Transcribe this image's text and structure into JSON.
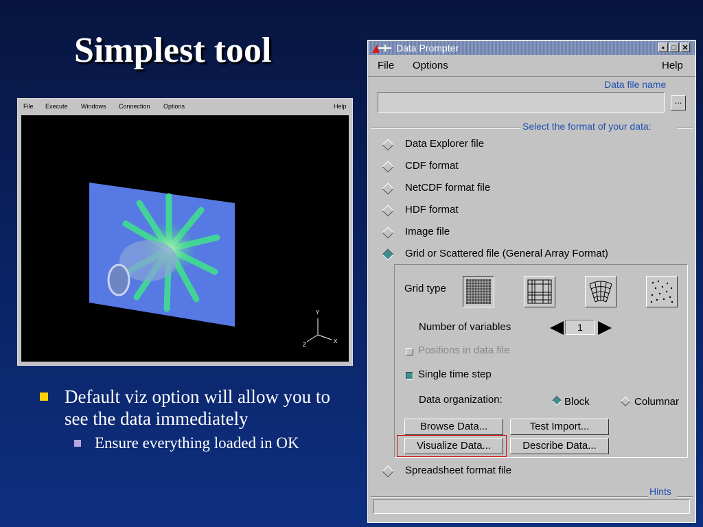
{
  "slide": {
    "title": "Simplest tool",
    "bullets": [
      {
        "text": "Default viz option will allow you to see the data immediately",
        "sub": [
          "Ensure everything loaded in OK"
        ]
      }
    ]
  },
  "viewer": {
    "menu": [
      "File",
      "Execute",
      "Windows",
      "Connection",
      "Options"
    ],
    "help": "Help",
    "axes": {
      "y": "Y",
      "z": "Z",
      "x": "X"
    }
  },
  "dialog": {
    "title": "Data Prompter",
    "menu": {
      "file": "File",
      "options": "Options",
      "help": "Help"
    },
    "file_name_label": "Data file name",
    "file_name_value": "",
    "browse_dots": "...",
    "format_label": "Select the format of your data:",
    "formats": [
      {
        "label": "Data Explorer file",
        "selected": false
      },
      {
        "label": "CDF format",
        "selected": false
      },
      {
        "label": "NetCDF format file",
        "selected": false
      },
      {
        "label": "HDF format",
        "selected": false
      },
      {
        "label": "Image file",
        "selected": false
      },
      {
        "label": "Grid or Scattered file (General Array Format)",
        "selected": true
      }
    ],
    "spreadsheet": {
      "label": "Spreadsheet format file",
      "selected": false
    },
    "grid_type_label": "Grid type",
    "grid_types": [
      "regular-grid-icon",
      "deformed-grid-icon",
      "curvilinear-grid-icon",
      "scattered-points-icon"
    ],
    "num_vars_label": "Number of variables",
    "num_vars_value": "1",
    "positions_label": "Positions in data file",
    "positions_checked": false,
    "single_step_label": "Single time step",
    "single_step_checked": true,
    "org_label": "Data organization:",
    "org_block": "Block",
    "org_columnar": "Columnar",
    "org_selected": "Block",
    "buttons": {
      "browse": "Browse Data...",
      "test_import": "Test Import...",
      "visualize": "Visualize Data...",
      "describe": "Describe Data..."
    },
    "hints_label": "Hints",
    "hints_value": "",
    "colors": {
      "accent_label": "#2050b0",
      "selected": "#3c8e8e",
      "highlight": "#d01010"
    }
  }
}
